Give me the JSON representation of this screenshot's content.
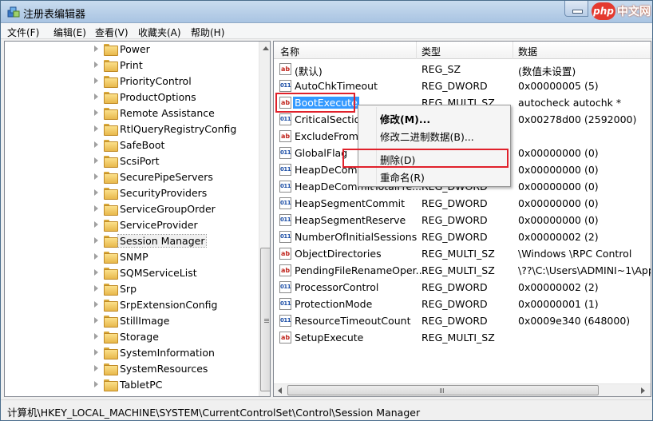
{
  "window": {
    "title": "注册表编辑器",
    "icon": "regedit-icon"
  },
  "watermark": {
    "brand": "php",
    "site": "中文网"
  },
  "menu": [
    "文件(F)",
    "编辑(E)",
    "查看(V)",
    "收藏夹(A)",
    "帮助(H)"
  ],
  "tree": {
    "items": [
      "Power",
      "Print",
      "PriorityControl",
      "ProductOptions",
      "Remote Assistance",
      "RtlQueryRegistryConfig",
      "SafeBoot",
      "ScsiPort",
      "SecurePipeServers",
      "SecurityProviders",
      "ServiceGroupOrder",
      "ServiceProvider",
      "Session Manager",
      "SNMP",
      "SQMServiceList",
      "Srp",
      "SrpExtensionConfig",
      "StillImage",
      "Storage",
      "SystemInformation",
      "SystemResources",
      "TabletPC"
    ],
    "selected": "Session Manager"
  },
  "list": {
    "columns": {
      "name": "名称",
      "type": "类型",
      "data": "数据"
    },
    "rows": [
      {
        "icon": "ab",
        "name": "(默认)",
        "type": "REG_SZ",
        "data": "(数值未设置)"
      },
      {
        "icon": "bin",
        "name": "AutoChkTimeout",
        "type": "REG_DWORD",
        "data": "0x00000005 (5)"
      },
      {
        "icon": "ab",
        "name": "BootExecute",
        "type": "REG_MULTI_SZ",
        "data": "autocheck autochk *"
      },
      {
        "icon": "bin",
        "name": "CriticalSectio",
        "type": "",
        "data": "0x00278d00 (2592000)"
      },
      {
        "icon": "ab",
        "name": "ExcludeFrom",
        "type": "",
        "data": ""
      },
      {
        "icon": "bin",
        "name": "GlobalFlag",
        "type": "",
        "data": "0x00000000 (0)"
      },
      {
        "icon": "bin",
        "name": "HeapDeCom",
        "type": "",
        "data": "0x00000000 (0)"
      },
      {
        "icon": "bin",
        "name": "HeapDeCommitTotalFre...",
        "type": "REG_DWORD",
        "data": "0x00000000 (0)"
      },
      {
        "icon": "bin",
        "name": "HeapSegmentCommit",
        "type": "REG_DWORD",
        "data": "0x00000000 (0)"
      },
      {
        "icon": "bin",
        "name": "HeapSegmentReserve",
        "type": "REG_DWORD",
        "data": "0x00000000 (0)"
      },
      {
        "icon": "bin",
        "name": "NumberOfInitialSessions",
        "type": "REG_DWORD",
        "data": "0x00000002 (2)"
      },
      {
        "icon": "ab",
        "name": "ObjectDirectories",
        "type": "REG_MULTI_SZ",
        "data": "\\Windows \\RPC Control"
      },
      {
        "icon": "ab",
        "name": "PendingFileRenameOper...",
        "type": "REG_MULTI_SZ",
        "data": "\\??\\C:\\Users\\ADMINI~1\\App"
      },
      {
        "icon": "bin",
        "name": "ProcessorControl",
        "type": "REG_DWORD",
        "data": "0x00000002 (2)"
      },
      {
        "icon": "bin",
        "name": "ProtectionMode",
        "type": "REG_DWORD",
        "data": "0x00000001 (1)"
      },
      {
        "icon": "bin",
        "name": "ResourceTimeoutCount",
        "type": "REG_DWORD",
        "data": "0x0009e340 (648000)"
      },
      {
        "icon": "ab",
        "name": "SetupExecute",
        "type": "REG_MULTI_SZ",
        "data": ""
      }
    ],
    "selected": "BootExecute"
  },
  "context_menu": {
    "items": [
      {
        "label": "修改(M)...",
        "bold": true
      },
      {
        "label": "修改二进制数据(B)..."
      },
      {
        "label": "删除(D)"
      },
      {
        "label": "重命名(R)"
      }
    ]
  },
  "status": {
    "path": "计算机\\HKEY_LOCAL_MACHINE\\SYSTEM\\CurrentControlSet\\Control\\Session Manager"
  },
  "colors": {
    "selection": "#3399ff",
    "highlight_box": "#e0212b"
  }
}
